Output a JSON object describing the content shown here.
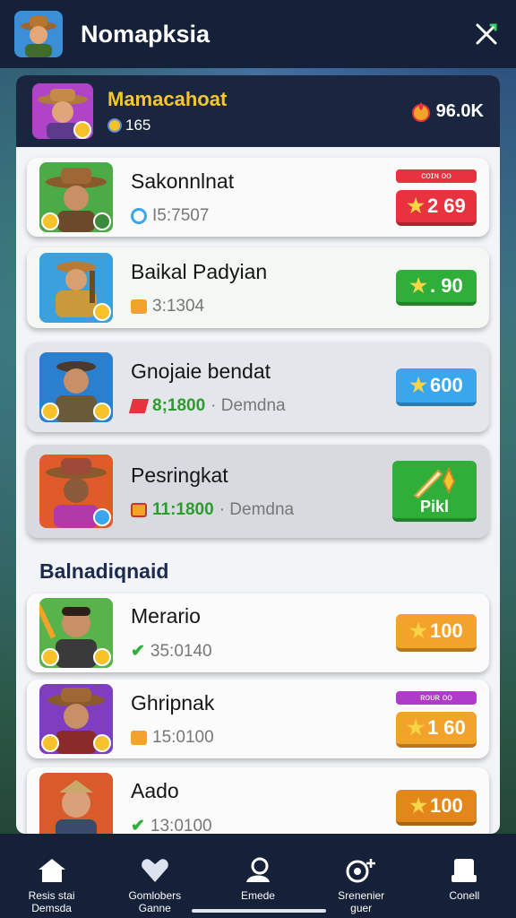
{
  "header": {
    "title": "Nomapksia",
    "avatar_icon": "adventurer-avatar-icon",
    "close_icon": "close-x-icon"
  },
  "player": {
    "name": "Mamacahoat",
    "level": "165",
    "coins": "96.0K"
  },
  "cards": [
    {
      "name": "Sakonnlnat",
      "sub_value": "I5:7507",
      "sub_extra": "",
      "button": "2 69",
      "tag": "ᴄᴏɪɴ ᴏᴏ",
      "accent": "#e8323f"
    },
    {
      "name": "Baikal Padyian",
      "sub_value": "3:1304",
      "sub_extra": "",
      "button": ". 90",
      "tag": "",
      "accent": "#2fae3a"
    },
    {
      "name": "Gnojaie bendat",
      "sub_value": "8;1800",
      "sub_extra": "· Demdna",
      "button": "600",
      "tag": "",
      "accent": "#3aa6ee"
    },
    {
      "name": "Pesringkat",
      "sub_value": "11:1800",
      "sub_extra": "· Demdna",
      "button": "Pikl",
      "tag": "",
      "accent": "#2fae3a"
    }
  ],
  "section_title": "Balnadiqnaid",
  "cards2": [
    {
      "name": "Merario",
      "sub_value": "35:0140",
      "button": "100",
      "tag": "",
      "accent": "#f3a22a"
    },
    {
      "name": "Ghripnak",
      "sub_value": "15:0100",
      "button": "1 60",
      "tag": "ʀᴏᴜʀ ᴏᴏ",
      "accent": "#f3a22a"
    },
    {
      "name": "Aado",
      "sub_value": "13:0100",
      "button": "100",
      "tag": "",
      "accent": "#e3861c"
    }
  ],
  "nav": [
    {
      "label": "Resis stai\nDemsda",
      "icon": "home-icon"
    },
    {
      "label": "Gomlobers\nGanne",
      "icon": "heart-icon"
    },
    {
      "label": "Emede",
      "icon": "profile-icon"
    },
    {
      "label": "Srenenier\nguer",
      "icon": "add-friend-icon"
    },
    {
      "label": "Conell",
      "icon": "inbox-icon"
    }
  ],
  "colors": {
    "header": "#152039",
    "panel": "#f2f4f7",
    "gold": "#f7c62e",
    "red": "#e8323f",
    "green": "#2fae3a",
    "blue": "#3aa6ee",
    "orange": "#f3a22a"
  }
}
